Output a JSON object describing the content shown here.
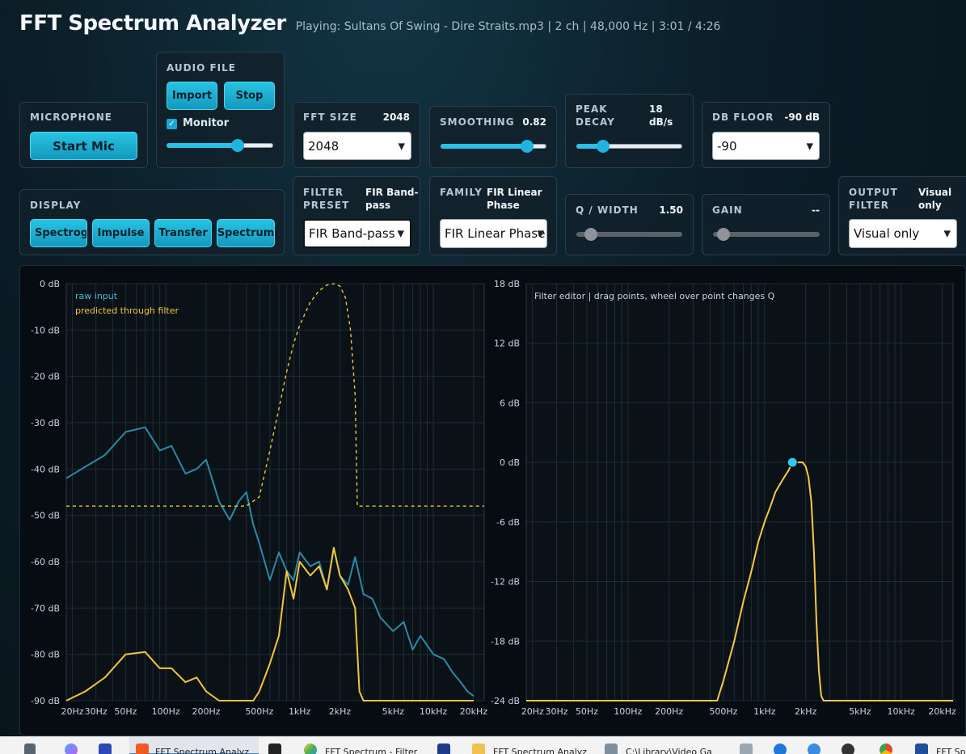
{
  "app": {
    "title": "FFT Spectrum Analyzer",
    "status": "Playing: Sultans Of Swing - Dire Straits.mp3 | 2 ch | 48,000 Hz | 3:01 / 4:26"
  },
  "microphone": {
    "label": "MICROPHONE",
    "start_label": "Start Mic"
  },
  "audio_file": {
    "label": "AUDIO FILE",
    "import_label": "Import",
    "stop_label": "Stop",
    "monitor_label": "Monitor",
    "monitor_checked": true,
    "volume_fraction": 0.67
  },
  "fft_size": {
    "label": "FFT SIZE",
    "value": "2048",
    "selected": "2048"
  },
  "smoothing": {
    "label": "SMOOTHING",
    "value": "0.82",
    "fraction": 0.82
  },
  "peak_decay": {
    "label_1": "PEAK",
    "label_2": "DECAY",
    "value_1": "18",
    "value_2": "dB/s",
    "fraction": 0.25
  },
  "db_floor": {
    "label": "DB FLOOR",
    "value": "-90 dB",
    "selected": "-90"
  },
  "display": {
    "label": "DISPLAY",
    "buttons": [
      "Spectrogram",
      "Impulse",
      "Transfer",
      "Spectrum"
    ]
  },
  "filter_preset": {
    "label_1": "FILTER",
    "label_2": "PRESET",
    "value_1": "FIR Band-",
    "value_2": "pass",
    "selected": "FIR Band-pass"
  },
  "family": {
    "label": "FAMILY",
    "value_1": "FIR Linear",
    "value_2": "Phase",
    "selected": "FIR Linear Phase"
  },
  "q_width": {
    "label": "Q / WIDTH",
    "value": "1.50",
    "fraction": 0.14
  },
  "gain": {
    "label": "GAIN",
    "value": "--",
    "fraction": 0.1
  },
  "output_filter": {
    "label_1": "OUTPUT",
    "label_2": "FILTER",
    "value_1": "Visual",
    "value_2": "only",
    "selected": "Visual only"
  },
  "left_plot": {
    "legend": [
      {
        "name": "raw input",
        "color": "#4fb6d3"
      },
      {
        "name": "predicted through filter",
        "color": "#f2c53d"
      }
    ],
    "y_ticks": [
      "0 dB",
      "-10 dB",
      "-20 dB",
      "-30 dB",
      "-40 dB",
      "-50 dB",
      "-60 dB",
      "-70 dB",
      "-80 dB",
      "-90 dB"
    ],
    "x_ticks": [
      "20Hz",
      "30Hz",
      "50Hz",
      "100Hz",
      "200Hz",
      "500Hz",
      "1kHz",
      "2kHz",
      "5kHz",
      "10kHz",
      "20kHz"
    ]
  },
  "right_plot": {
    "label": "Filter editor | drag points, wheel over point changes Q",
    "y_ticks": [
      "18 dB",
      "12 dB",
      "6 dB",
      "0 dB",
      "-6 dB",
      "-12 dB",
      "-18 dB",
      "-24 dB"
    ],
    "x_ticks": [
      "20Hz",
      "30Hz",
      "50Hz",
      "100Hz",
      "200Hz",
      "500Hz",
      "1kHz",
      "2kHz",
      "5kHz",
      "10kHz",
      "20kHz"
    ]
  },
  "chart_data": [
    {
      "type": "line",
      "xscale": "log",
      "xlim": [
        18,
        24000
      ],
      "ylim": [
        -90,
        0
      ],
      "series": [
        {
          "name": "raw input",
          "x": [
            18,
            25,
            35,
            50,
            70,
            90,
            110,
            140,
            170,
            200,
            250,
            300,
            350,
            400,
            450,
            500,
            600,
            700,
            800,
            900,
            1000,
            1200,
            1400,
            1600,
            1800,
            2000,
            2300,
            2600,
            3000,
            3500,
            4000,
            5000,
            6000,
            7000,
            8000,
            10000,
            12000,
            14000,
            16000,
            18000,
            20000
          ],
          "y": [
            -42,
            -39.5,
            -37,
            -32,
            -31,
            -36,
            -35,
            -41,
            -40,
            -38,
            -47,
            -51,
            -47,
            -45,
            -52,
            -56,
            -64,
            -58,
            -62,
            -64,
            -58,
            -61,
            -60,
            -66,
            -57,
            -63,
            -65,
            -59,
            -67,
            -68,
            -72,
            -75,
            -73,
            -79,
            -76,
            -80,
            -81,
            -84,
            -86,
            -88,
            -89
          ]
        },
        {
          "name": "predicted through filter",
          "x": [
            18,
            25,
            35,
            50,
            70,
            90,
            110,
            140,
            170,
            200,
            250,
            300,
            350,
            400,
            450,
            500,
            600,
            700,
            800,
            900,
            1000,
            1200,
            1400,
            1600,
            1800,
            2000,
            2300,
            2600,
            2800,
            3000,
            3500,
            5000,
            10000,
            20000
          ],
          "y": [
            -90,
            -88,
            -85,
            -80,
            -79.5,
            -83,
            -83,
            -86,
            -85,
            -88,
            -90,
            -90,
            -90,
            -90,
            -90,
            -88,
            -82,
            -76,
            -62,
            -68,
            -60,
            -63,
            -61,
            -66,
            -57,
            -63,
            -66,
            -70,
            -88,
            -90,
            -90,
            -90,
            -90,
            -90
          ]
        },
        {
          "name": "filter response (dashed)",
          "x": [
            18,
            400,
            500,
            600,
            700,
            800,
            900,
            1000,
            1200,
            1400,
            1600,
            1800,
            2000,
            2200,
            2400,
            2600,
            2700,
            3000,
            5000,
            24000
          ],
          "y": [
            -48,
            -48,
            -46,
            -36,
            -27,
            -19,
            -13,
            -9,
            -4,
            -1.5,
            -0.3,
            0,
            -0.5,
            -3,
            -10,
            -24,
            -48,
            -48,
            -48,
            -48
          ]
        }
      ]
    },
    {
      "type": "line",
      "xscale": "log",
      "xlim": [
        18,
        24000
      ],
      "ylim": [
        -24,
        18
      ],
      "series": [
        {
          "name": "filter response",
          "x": [
            18,
            450,
            500,
            600,
            700,
            800,
            900,
            1000,
            1100,
            1200,
            1350,
            1500,
            1600,
            1700,
            1800,
            1900,
            2000,
            2100,
            2200,
            2300,
            2400,
            2500,
            2600,
            2700,
            24000
          ],
          "y": [
            -24,
            -24,
            -22,
            -18,
            -14,
            -11,
            -8,
            -6,
            -4.5,
            -3,
            -1.8,
            -0.8,
            0,
            0,
            0,
            0,
            -0.4,
            -1.5,
            -4,
            -9,
            -16,
            -21,
            -23.5,
            -24,
            -24
          ]
        }
      ],
      "control_point": {
        "x": 1600,
        "y": 0
      }
    }
  ],
  "taskbar": {
    "items": [
      "FFT Spectrum Analyz",
      "FFT Spectrum - Filter",
      "FFT Spectrum Analyz",
      "C:\\Library\\Video Ga",
      "FFT Spe"
    ]
  }
}
